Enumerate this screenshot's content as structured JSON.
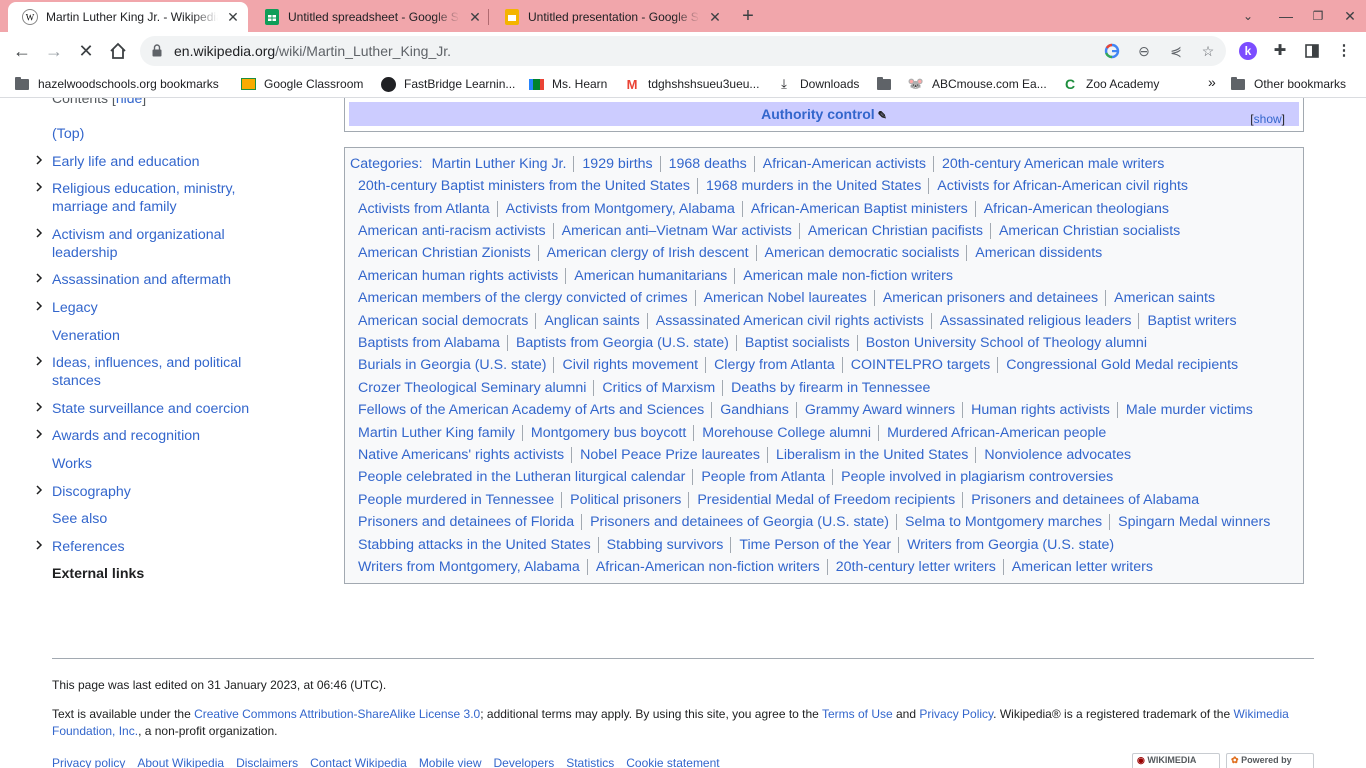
{
  "browser": {
    "tabs": [
      {
        "title": "Martin Luther King Jr. - Wikipedia",
        "favicon": "wikipedia-w",
        "active": true
      },
      {
        "title": "Untitled spreadsheet - Google Sheets",
        "favicon": "sheets",
        "active": false
      },
      {
        "title": "Untitled presentation - Google Slides",
        "favicon": "slides",
        "active": false
      }
    ],
    "url_host": "en.wikipedia.org",
    "url_path": "/wiki/Martin_Luther_King_Jr.",
    "profile_initial": "k",
    "tabstrip_color": "#f1a6ab"
  },
  "bookmarks": {
    "items": [
      {
        "label": "hazelwoodschools.org bookmarks",
        "icon": "folder"
      },
      {
        "label": "Google Classroom",
        "icon": "classroom"
      },
      {
        "label": "FastBridge Learnin...",
        "icon": "fastbridge"
      },
      {
        "label": "Ms. Hearn",
        "icon": "meet"
      },
      {
        "label": "tdghshshsueu3ueu...",
        "icon": "gmail"
      },
      {
        "label": "Downloads",
        "icon": "download"
      },
      {
        "label": "",
        "icon": "folder"
      },
      {
        "label": "ABCmouse.com Ea...",
        "icon": "abcmouse"
      },
      {
        "label": "Zoo Academy",
        "icon": "zoo"
      }
    ],
    "overflow": "»",
    "other": "Other bookmarks"
  },
  "toc": {
    "header": "Contents",
    "hide": "hide",
    "items": [
      {
        "label": "(Top)",
        "expandable": false
      },
      {
        "label": "Early life and education",
        "expandable": true
      },
      {
        "label": "Religious education, ministry, marriage and family",
        "expandable": true
      },
      {
        "label": "Activism and organizational leadership",
        "expandable": true
      },
      {
        "label": "Assassination and aftermath",
        "expandable": true
      },
      {
        "label": "Legacy",
        "expandable": true
      },
      {
        "label": "Veneration",
        "expandable": false
      },
      {
        "label": "Ideas, influences, and political stances",
        "expandable": true
      },
      {
        "label": "State surveillance and coercion",
        "expandable": true
      },
      {
        "label": "Awards and recognition",
        "expandable": true
      },
      {
        "label": "Works",
        "expandable": false
      },
      {
        "label": "Discography",
        "expandable": true
      },
      {
        "label": "See also",
        "expandable": false
      },
      {
        "label": "References",
        "expandable": true
      },
      {
        "label": "External links",
        "expandable": false,
        "current": true
      }
    ]
  },
  "navbox": {
    "title": "Authority control",
    "show": "show"
  },
  "categories": {
    "label": "Categories",
    "rows": [
      [
        "Martin Luther King Jr.",
        "1929 births",
        "1968 deaths",
        "African-American activists",
        "20th-century American male writers"
      ],
      [
        "20th-century Baptist ministers from the United States",
        "1968 murders in the United States",
        "Activists for African-American civil rights"
      ],
      [
        "Activists from Atlanta",
        "Activists from Montgomery, Alabama",
        "African-American Baptist ministers",
        "African-American theologians"
      ],
      [
        "American anti-racism activists",
        "American anti–Vietnam War activists",
        "American Christian pacifists",
        "American Christian socialists"
      ],
      [
        "American Christian Zionists",
        "American clergy of Irish descent",
        "American democratic socialists",
        "American dissidents"
      ],
      [
        "American human rights activists",
        "American humanitarians",
        "American male non-fiction writers"
      ],
      [
        "American members of the clergy convicted of crimes",
        "American Nobel laureates",
        "American prisoners and detainees",
        "American saints"
      ],
      [
        "American social democrats",
        "Anglican saints",
        "Assassinated American civil rights activists",
        "Assassinated religious leaders",
        "Baptist writers"
      ],
      [
        "Baptists from Alabama",
        "Baptists from Georgia (U.S. state)",
        "Baptist socialists",
        "Boston University School of Theology alumni"
      ],
      [
        "Burials in Georgia (U.S. state)",
        "Civil rights movement",
        "Clergy from Atlanta",
        "COINTELPRO targets",
        "Congressional Gold Medal recipients"
      ],
      [
        "Crozer Theological Seminary alumni",
        "Critics of Marxism",
        "Deaths by firearm in Tennessee"
      ],
      [
        "Fellows of the American Academy of Arts and Sciences",
        "Gandhians",
        "Grammy Award winners",
        "Human rights activists",
        "Male murder victims"
      ],
      [
        "Martin Luther King family",
        "Montgomery bus boycott",
        "Morehouse College alumni",
        "Murdered African-American people"
      ],
      [
        "Native Americans' rights activists",
        "Nobel Peace Prize laureates",
        "Liberalism in the United States",
        "Nonviolence advocates"
      ],
      [
        "People celebrated in the Lutheran liturgical calendar",
        "People from Atlanta",
        "People involved in plagiarism controversies"
      ],
      [
        "People murdered in Tennessee",
        "Political prisoners",
        "Presidential Medal of Freedom recipients",
        "Prisoners and detainees of Alabama"
      ],
      [
        "Prisoners and detainees of Florida",
        "Prisoners and detainees of Georgia (U.S. state)",
        "Selma to Montgomery marches",
        "Spingarn Medal winners"
      ],
      [
        "Stabbing attacks in the United States",
        "Stabbing survivors",
        "Time Person of the Year",
        "Writers from Georgia (U.S. state)"
      ],
      [
        "Writers from Montgomery, Alabama",
        "African-American non-fiction writers",
        "20th-century letter writers",
        "American letter writers"
      ]
    ]
  },
  "footer": {
    "last_edited": "This page was last edited on 31 January 2023, at 06:46 (UTC).",
    "license_pre": "Text is available under the ",
    "license_link": "Creative Commons Attribution-ShareAlike License 3.0",
    "license_mid": "; additional terms may apply. By using this site, you agree to the ",
    "terms_link": "Terms of Use",
    "and": " and ",
    "privacy_link": "Privacy Policy",
    "trademark": ". Wikipedia® is a registered trademark of the ",
    "wmf_link_a": "Wikimedia",
    "wmf_link_b": "Foundation, Inc.",
    "nonprofit": ", a non-profit organization.",
    "links": [
      "Privacy policy",
      "About Wikipedia",
      "Disclaimers",
      "Contact Wikipedia",
      "Mobile view",
      "Developers",
      "Statistics",
      "Cookie statement"
    ],
    "badge_wikimedia": "WIKIMEDIA",
    "badge_powered": "Powered by"
  }
}
